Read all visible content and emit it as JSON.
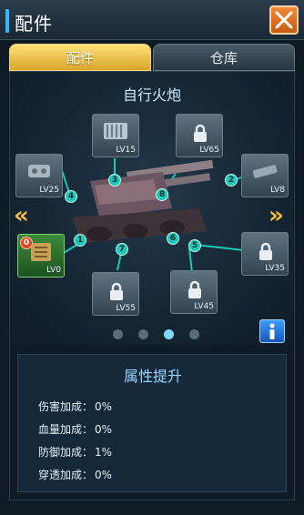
{
  "window": {
    "title": "配件"
  },
  "tabs": [
    {
      "label": "配件",
      "active": true
    },
    {
      "label": "仓库",
      "active": false
    }
  ],
  "vehicle": {
    "name": "自行火炮"
  },
  "slots": [
    {
      "lv": "LV15",
      "node": "3",
      "locked": false
    },
    {
      "lv": "LV65",
      "node": "",
      "locked": true
    },
    {
      "lv": "LV25",
      "node": "4",
      "locked": false
    },
    {
      "lv": "LV8",
      "node": "2",
      "locked": false
    },
    {
      "lv": "LV0",
      "node": "1",
      "locked": false,
      "badge": "0"
    },
    {
      "lv": "LV35",
      "node": "5",
      "locked": true
    },
    {
      "lv": "LV55",
      "node": "7",
      "locked": true
    },
    {
      "lv": "LV45",
      "node": "6",
      "locked": true
    }
  ],
  "extra_nodes": [
    "8"
  ],
  "pager": {
    "count": 4,
    "active_index": 2
  },
  "stats": {
    "title": "属性提升",
    "rows": [
      {
        "label": "伤害加成：",
        "value": "0%"
      },
      {
        "label": "血量加成：",
        "value": "0%"
      },
      {
        "label": "防御加成：",
        "value": "1%"
      },
      {
        "label": "穿透加成：",
        "value": "0%"
      }
    ]
  },
  "colors": {
    "accent": "#33b7ff",
    "node": "#1ec8b8",
    "tab_active": "#e0b43a",
    "close": "#e0731f"
  },
  "icons": [
    "close-icon",
    "lock-icon",
    "info-icon",
    "chevron-left-icon",
    "chevron-right-icon"
  ]
}
